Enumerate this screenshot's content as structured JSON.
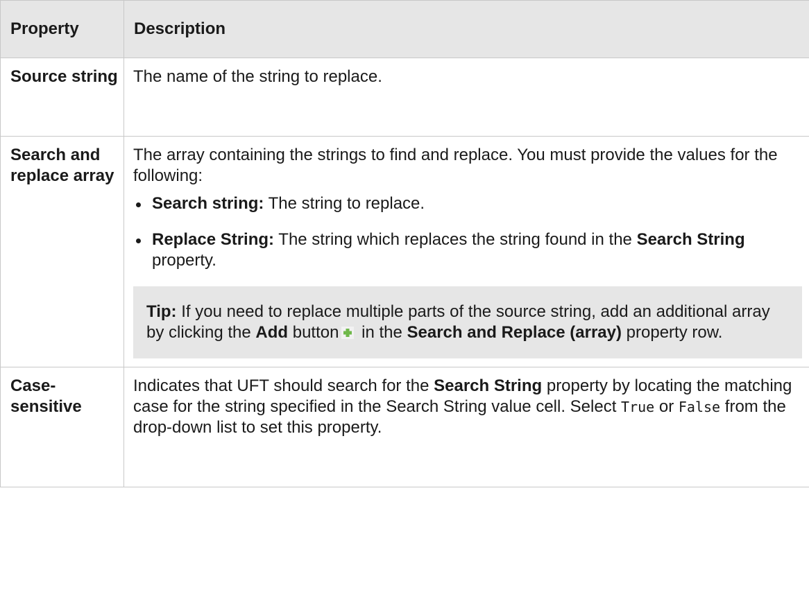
{
  "table": {
    "headers": {
      "property": "Property",
      "description": "Description"
    },
    "rows": [
      {
        "property": "Source string",
        "description": "The name of the string to replace."
      },
      {
        "property": "Search and replace array",
        "intro": "The array containing the strings to find and replace. You must provide the values for the following:",
        "bullets": [
          {
            "term": "Search string:",
            "text": " The string to replace."
          },
          {
            "term": "Replace String:",
            "text": " The string which replaces the string found in the ",
            "term2": "Search String",
            "text2": " property."
          }
        ],
        "tip": {
          "label": "Tip:",
          "text1": " If you need to replace multiple parts of the source string, add an additional array by clicking the ",
          "add": "Add",
          "text2": " button",
          "text3": " in the ",
          "bold2": "Search and Replace (array)",
          "text4": " property row."
        }
      },
      {
        "property": "Case-sensitive",
        "text1": "Indicates that UFT should search for the ",
        "bold1": "Search String",
        "text2": " property by locating the matching case for the string specified in the Search String value cell. Select ",
        "code1": "True",
        "text3": " or ",
        "code2": "False",
        "text4": " from the drop-down list to set this property."
      }
    ]
  },
  "icons": {
    "add": "plus-icon"
  },
  "colors": {
    "header_bg": "#e6e6e6",
    "tip_bg": "#e6e6e6",
    "plus": "#6fb84a"
  }
}
